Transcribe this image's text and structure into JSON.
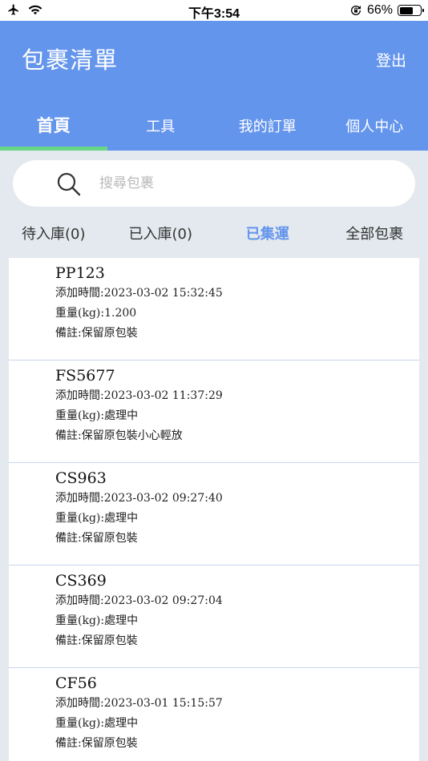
{
  "status_bar": {
    "time": "下午3:54",
    "battery_percent": "66%",
    "battery_level": 0.66
  },
  "header": {
    "title": "包裹清單",
    "logout_label": "登出"
  },
  "tabs": [
    {
      "label": "首頁",
      "active": true
    },
    {
      "label": "工具",
      "active": false
    },
    {
      "label": "我的訂單",
      "active": false
    },
    {
      "label": "個人中心",
      "active": false
    }
  ],
  "search": {
    "placeholder": "搜尋包裹",
    "value": ""
  },
  "filters": [
    {
      "label": "待入庫(0)",
      "active": false
    },
    {
      "label": "已入庫(0)",
      "active": false
    },
    {
      "label": "已集運",
      "active": true
    },
    {
      "label": "全部包裹",
      "active": false
    }
  ],
  "packages": [
    {
      "id": "PP123",
      "added": "添加時間:2023-03-02 15:32:45",
      "weight": "重量(kg):1.200",
      "note": "備註:保留原包裝"
    },
    {
      "id": "FS5677",
      "added": "添加時間:2023-03-02 11:37:29",
      "weight": "重量(kg):處理中",
      "note": "備註:保留原包裝小心輕放"
    },
    {
      "id": "CS963",
      "added": "添加時間:2023-03-02 09:27:40",
      "weight": "重量(kg):處理中",
      "note": "備註:保留原包裝"
    },
    {
      "id": "CS369",
      "added": "添加時間:2023-03-02 09:27:04",
      "weight": "重量(kg):處理中",
      "note": "備註:保留原包裝"
    },
    {
      "id": "CF56",
      "added": "添加時間:2023-03-01 15:15:57",
      "weight": "重量(kg):處理中",
      "note": "備註:保留原包裝"
    }
  ],
  "colors": {
    "header": "#6495ed",
    "tab_indicator": "#67d686",
    "active_filter": "#6495ed",
    "background": "#e3e9ee"
  },
  "icons": {
    "airplane": "airplane-icon",
    "wifi": "wifi-icon",
    "rotation_lock": "rotation-lock-icon",
    "battery": "battery-icon",
    "search": "search-icon"
  }
}
